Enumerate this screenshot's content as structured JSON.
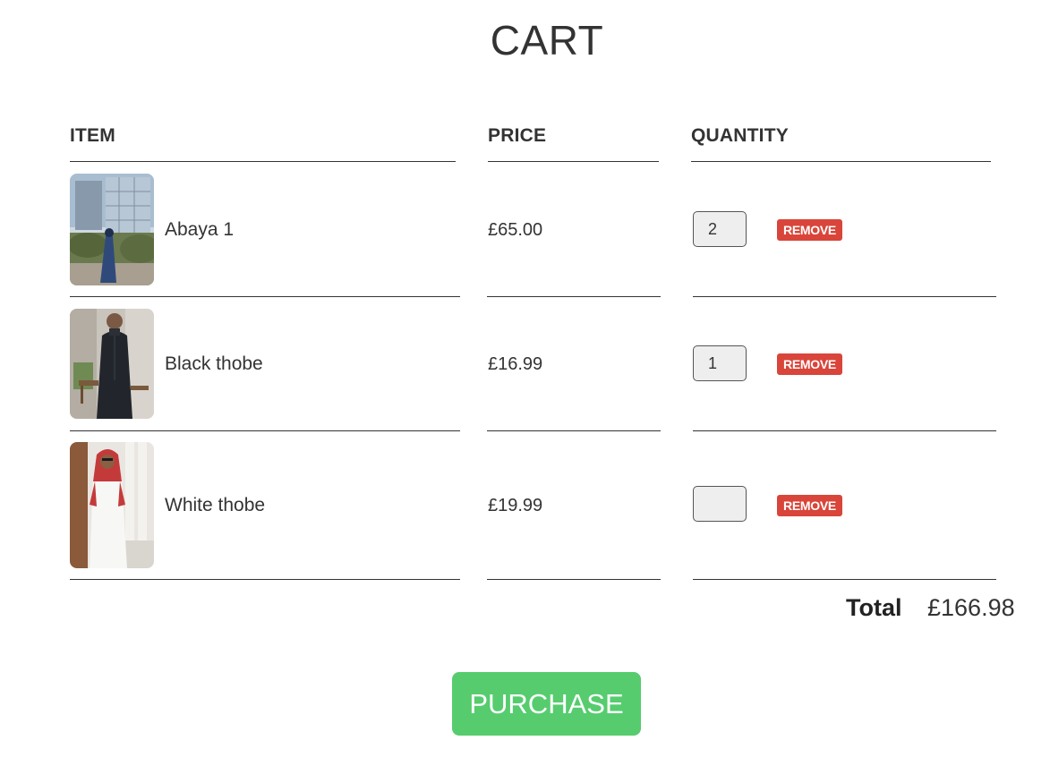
{
  "page_title": "CART",
  "columns": {
    "item": "ITEM",
    "price": "PRICE",
    "quantity": "QUANTITY"
  },
  "items": [
    {
      "name": "Abaya 1",
      "price": "£65.00",
      "quantity": "2",
      "remove_label": "REMOVE",
      "image": "abaya-photo"
    },
    {
      "name": "Black thobe",
      "price": "£16.99",
      "quantity": "1",
      "remove_label": "REMOVE",
      "image": "black-thobe-photo"
    },
    {
      "name": "White thobe",
      "price": "£19.99",
      "quantity": "",
      "remove_label": "REMOVE",
      "image": "white-thobe-photo"
    }
  ],
  "total": {
    "label": "Total",
    "value": "£166.98"
  },
  "purchase_label": "PURCHASE",
  "colors": {
    "remove": "#d9453a",
    "purchase": "#56cc6e",
    "text": "#333333"
  }
}
